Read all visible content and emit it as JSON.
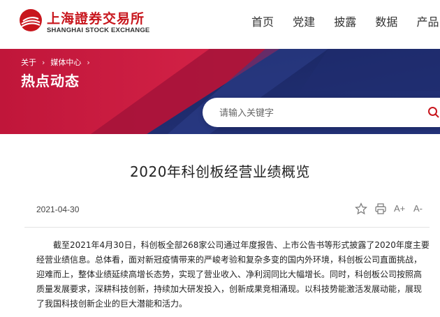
{
  "header": {
    "logo_cn": "上海證券交易所",
    "logo_en": "SHANGHAI STOCK EXCHANGE",
    "nav": [
      "首页",
      "党建",
      "披露",
      "数据",
      "产品"
    ]
  },
  "banner": {
    "breadcrumb": [
      "关于",
      "媒体中心"
    ],
    "title": "热点动态"
  },
  "search": {
    "placeholder": "请输入关键字"
  },
  "article": {
    "title": "2020年科创板经营业绩概览",
    "date": "2021-04-30",
    "body_lines": [
      "截至2021年4月30日，科创板全部268家公司通过年度报告、上市公告书等形式披露了2020年度主要",
      "经营业绩信息。总体看，面对新冠疫情带来的严峻考验和复杂多变的国内外环境，科创板公司直面挑战，",
      "迎难而上，整体业绩延续高增长态势，实现了营业收入、净利润同比大幅增长。同时，科创板公司按照高",
      "质量发展要求，深耕科技创新，持续加大研发投入，创新成果竞相涌现。以科技势能激活发展动能，展现",
      "了我国科技创新企业的巨大潜能和活力。"
    ]
  },
  "tools": {
    "font_increase": "A+",
    "font_decrease": "A-"
  },
  "colors": {
    "brand_red": "#c8161d",
    "banner_navy": "#1c2a6b"
  }
}
